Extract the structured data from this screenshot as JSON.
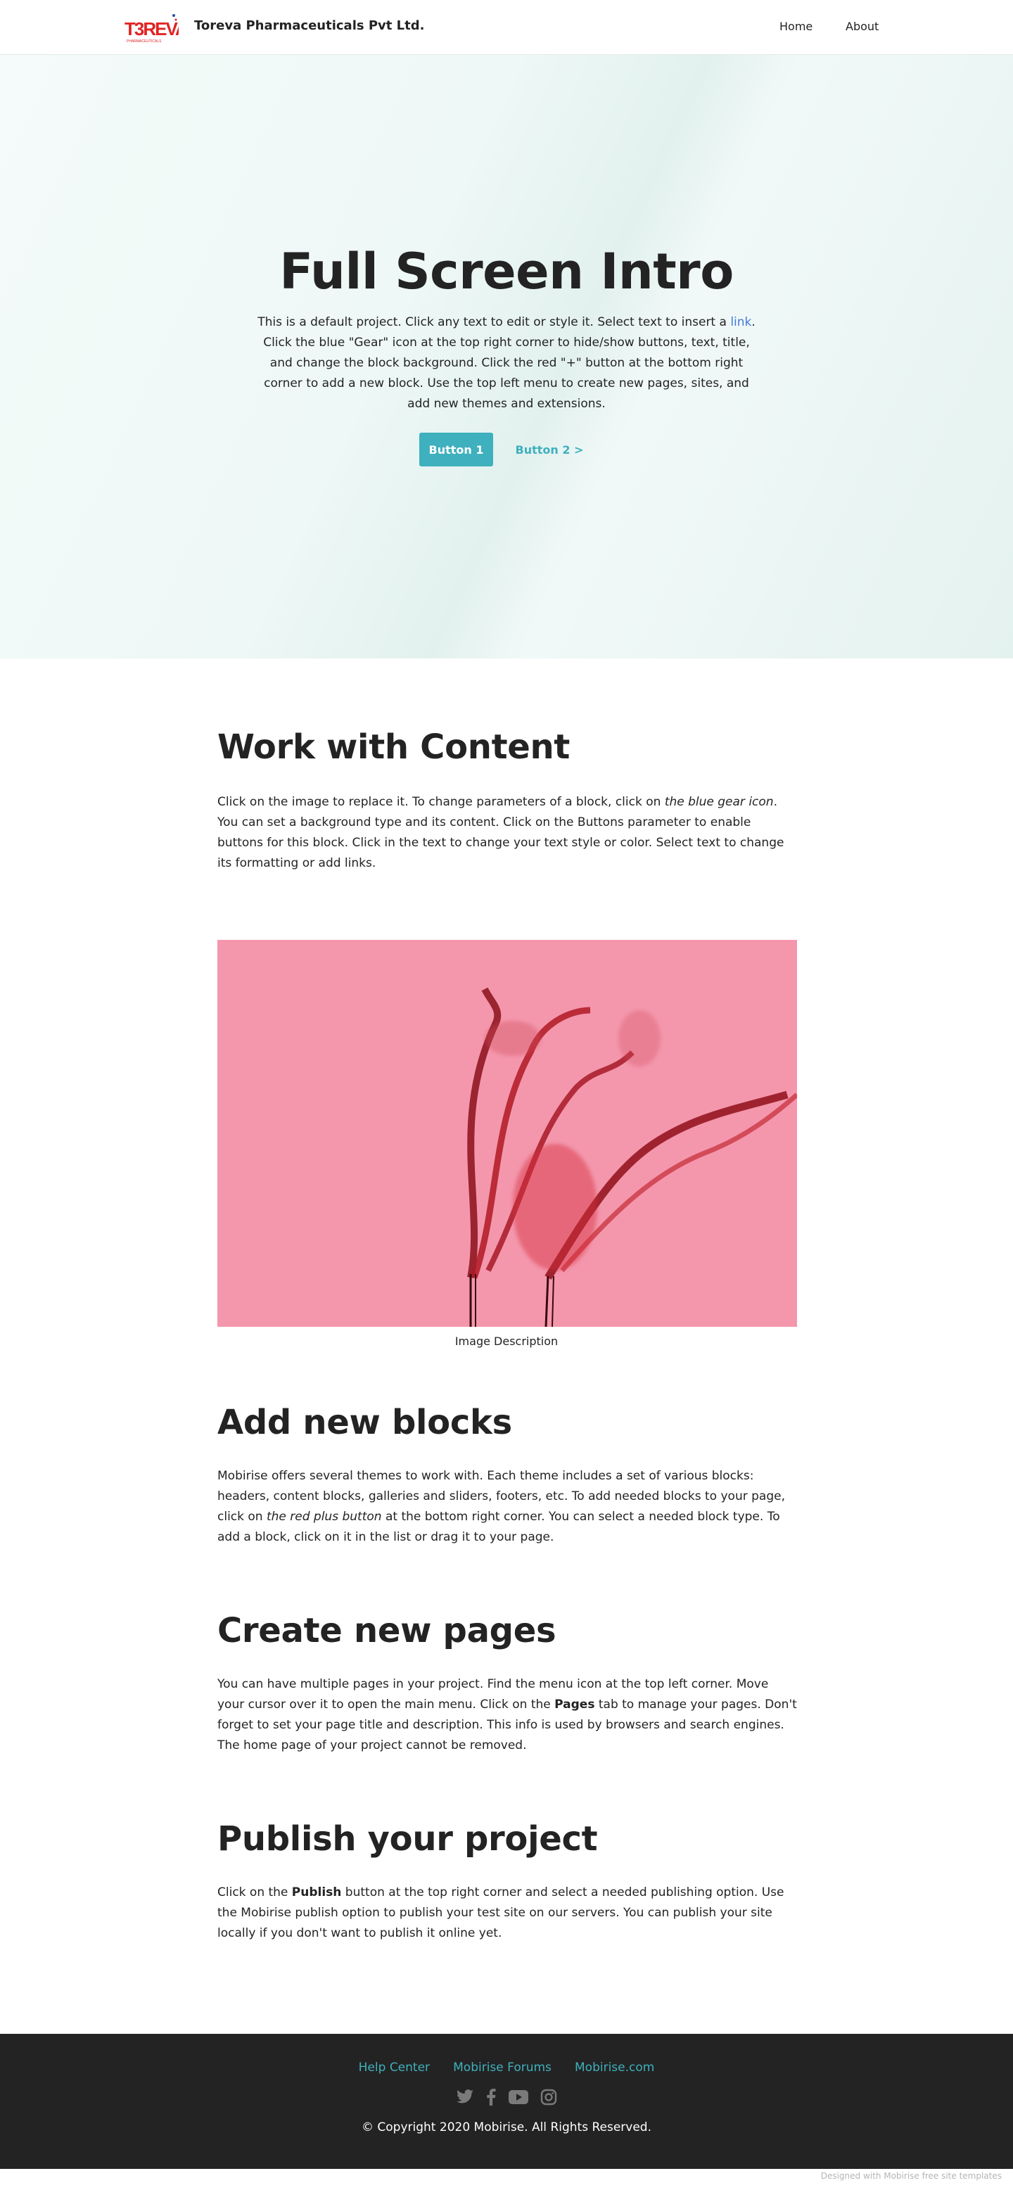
{
  "navbar": {
    "brand": "Toreva Pharmaceuticals Pvt Ltd.",
    "logo_text": "TOREVA",
    "links": [
      {
        "label": "Home"
      },
      {
        "label": "About"
      }
    ]
  },
  "hero": {
    "title": "Full Screen Intro",
    "text_before_link": "This is a default project. Click any text to edit or style it. Select text to insert a ",
    "link_label": "link",
    "text_after_link": ". Click the blue \"Gear\" icon at the top right corner to hide/show buttons, text, title, and change the block background. Click the red \"+\" button at the bottom right corner to add a new block. Use the top left menu to create new pages, sites, and add new themes and extensions.",
    "button1_label": "Button 1",
    "button2_label": "Button 2 >"
  },
  "sections": {
    "work": {
      "title": "Work with Content",
      "text_a": "Click on the image to replace it. To change parameters of a block, click on ",
      "text_em": "the blue gear icon",
      "text_b": ". You can set a background type and its content. Click on the Buttons parameter to enable buttons for this block. Click in the text to change your text style or color. Select text to change its formatting or add links."
    },
    "image_caption": "Image Description",
    "blocks": {
      "title": "Add new blocks",
      "text_a": "Mobirise offers several themes to work with. Each theme includes a set of various blocks: headers, content blocks, galleries and sliders, footers, etc. To add needed blocks to your page, click on ",
      "text_em": "the red plus button",
      "text_b": " at the bottom right corner. You can select a needed block type. To add a block, click on it in the list or drag it to your page."
    },
    "pages": {
      "title": "Create new pages",
      "text_a": "You can have multiple pages in your project. Find the menu icon at the top left corner. Move your cursor over it to open the main menu. Click on the ",
      "text_strong": "Pages",
      "text_b": " tab to manage your pages. Don't forget to set your page title and description. This info is used by browsers and search engines. The home page of your project cannot be removed."
    },
    "publish": {
      "title": "Publish your project",
      "text_a": "Click on the ",
      "text_strong": "Publish",
      "text_b": " button at the top right corner and select a needed publishing option. Use the Mobirise publish option to publish your test site on our servers. You can publish your site locally if you don't want to publish it online yet."
    }
  },
  "footer": {
    "links": [
      {
        "label": "Help Center"
      },
      {
        "label": "Mobirise Forums"
      },
      {
        "label": "Mobirise.com"
      }
    ],
    "social_icons": [
      "twitter-icon",
      "facebook-icon",
      "youtube-icon",
      "instagram-icon"
    ],
    "copyright": "© Copyright 2020 Mobirise. All Rights Reserved.",
    "credit": "Designed with Mobirise free site templates"
  },
  "colors": {
    "accent": "#3fb0bd",
    "link": "#4479d9",
    "image_bg": "#f497ad",
    "footer_bg": "#232323"
  }
}
